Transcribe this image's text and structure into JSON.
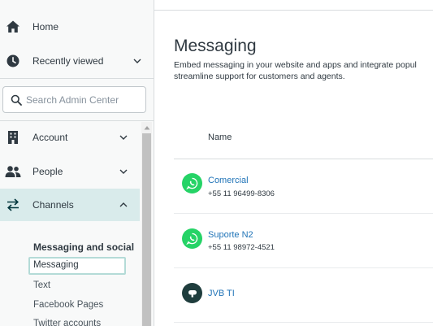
{
  "sidebar": {
    "home_label": "Home",
    "recent_label": "Recently viewed",
    "search_placeholder": "Search Admin Center",
    "account_label": "Account",
    "people_label": "People",
    "channels_label": "Channels",
    "messaging_social_heading": "Messaging and social",
    "sub_items": [
      "Messaging",
      "Text",
      "Facebook Pages",
      "Twitter accounts"
    ]
  },
  "main": {
    "title": "Messaging",
    "description_line1": "Embed messaging in your website and apps and integrate popul",
    "description_line2": "streamline support for customers and agents.",
    "column_name": "Name",
    "rows": [
      {
        "name": "Comercial",
        "phone": "+55 11 96499-8306",
        "icon": "whatsapp-icon"
      },
      {
        "name": "Suporte N2",
        "phone": "+55 11 98972-4521",
        "icon": "whatsapp-icon"
      },
      {
        "name": "JVB TI",
        "phone": "",
        "icon": "web-widget-icon"
      }
    ]
  },
  "colors": {
    "accent": "#1f73b7",
    "active_nav_bg": "#d9ebeb",
    "whatsapp": "#25d366",
    "widget": "#1f3d3d"
  }
}
